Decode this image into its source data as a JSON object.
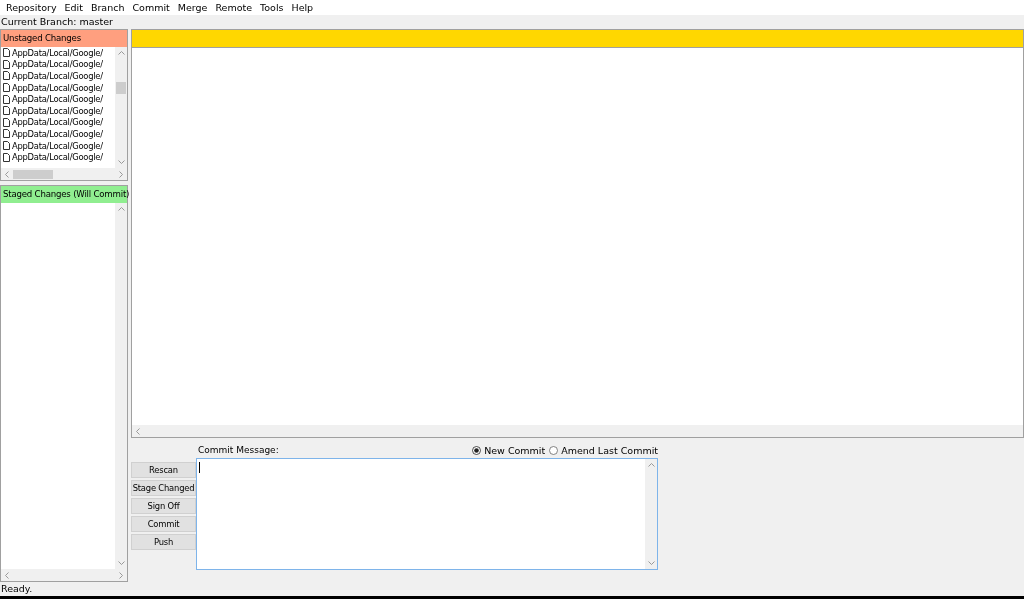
{
  "menu": [
    "Repository",
    "Edit",
    "Branch",
    "Commit",
    "Merge",
    "Remote",
    "Tools",
    "Help"
  ],
  "current_branch": "Current Branch: master",
  "unstaged": {
    "title": "Unstaged Changes",
    "files": [
      "AppData/Local/Google/",
      "AppData/Local/Google/",
      "AppData/Local/Google/",
      "AppData/Local/Google/",
      "AppData/Local/Google/",
      "AppData/Local/Google/",
      "AppData/Local/Google/",
      "AppData/Local/Google/",
      "AppData/Local/Google/",
      "AppData/Local/Google/"
    ]
  },
  "staged": {
    "title": "Staged Changes (Will Commit)"
  },
  "commit": {
    "label": "Commit Message:",
    "modes": [
      {
        "label": "New Commit",
        "selected": true
      },
      {
        "label": "Amend Last Commit",
        "selected": false
      }
    ]
  },
  "buttons": [
    "Rescan",
    "Stage Changed",
    "Sign Off",
    "Commit",
    "Push"
  ],
  "status_bar": "Ready."
}
